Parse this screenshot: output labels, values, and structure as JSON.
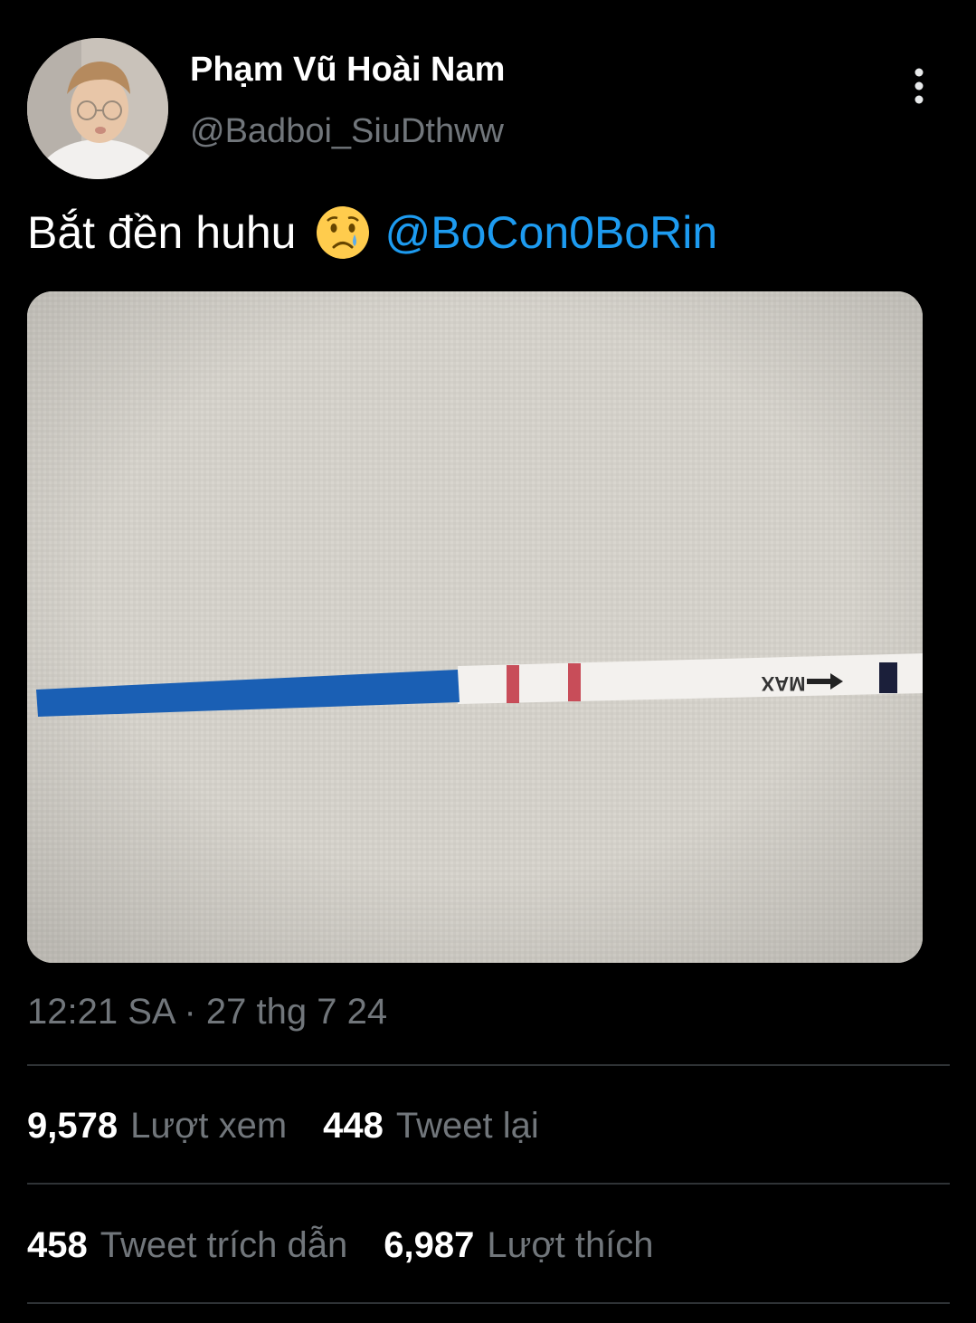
{
  "user": {
    "display_name": "Phạm Vũ Hoài Nam",
    "handle": "@Badboi_SiuDthww"
  },
  "tweet": {
    "text": "Bắt đền huhu",
    "emoji": "crying-face",
    "mention": "@BoCon0BoRin",
    "media_strip_label": "MAX",
    "timestamp": "12:21 SA · 27 thg 7 24"
  },
  "stats": {
    "views_count": "9,578",
    "views_label": "Lượt xem",
    "retweets_count": "448",
    "retweets_label": "Tweet lại",
    "quotes_count": "458",
    "quotes_label": "Tweet trích dẫn",
    "likes_count": "6,987",
    "likes_label": "Lượt thích"
  },
  "colors": {
    "background": "#000000",
    "text": "#ffffff",
    "secondary": "#71767b",
    "accent": "#1d9bf0",
    "divider": "#2f3336"
  }
}
